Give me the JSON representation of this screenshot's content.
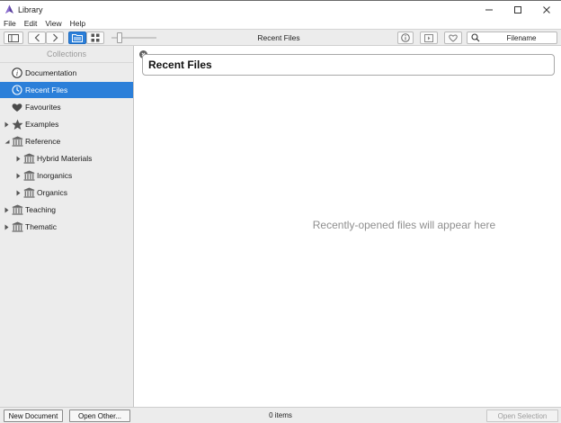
{
  "window": {
    "title": "Library"
  },
  "menu": {
    "items": [
      "File",
      "Edit",
      "View",
      "Help"
    ]
  },
  "toolbar": {
    "location_title": "Recent Files",
    "search": {
      "placeholder": "Filename",
      "value": ""
    }
  },
  "sidebar": {
    "header": "Collections",
    "items": [
      {
        "label": "Documentation",
        "icon": "info-icon"
      },
      {
        "label": "Recent Files",
        "icon": "clock-icon"
      },
      {
        "label": "Favourites",
        "icon": "heart-icon"
      },
      {
        "label": "Examples",
        "icon": "star-icon"
      },
      {
        "label": "Reference",
        "icon": "library-icon"
      },
      {
        "label": "Hybrid Materials",
        "icon": "library-icon"
      },
      {
        "label": "Inorganics",
        "icon": "library-icon"
      },
      {
        "label": "Organics",
        "icon": "library-icon"
      },
      {
        "label": "Teaching",
        "icon": "library-icon"
      },
      {
        "label": "Thematic",
        "icon": "library-icon"
      }
    ]
  },
  "content": {
    "heading": "Recent Files",
    "empty_message": "Recently-opened files will appear here"
  },
  "status": {
    "new_document_label": "New Document",
    "open_other_label": "Open Other...",
    "item_count": "0 items",
    "open_selection_label": "Open Selection"
  },
  "colors": {
    "accent": "#2b7fd9",
    "sidebar_bg": "#ececec",
    "toolbar_bg": "#ececec"
  }
}
